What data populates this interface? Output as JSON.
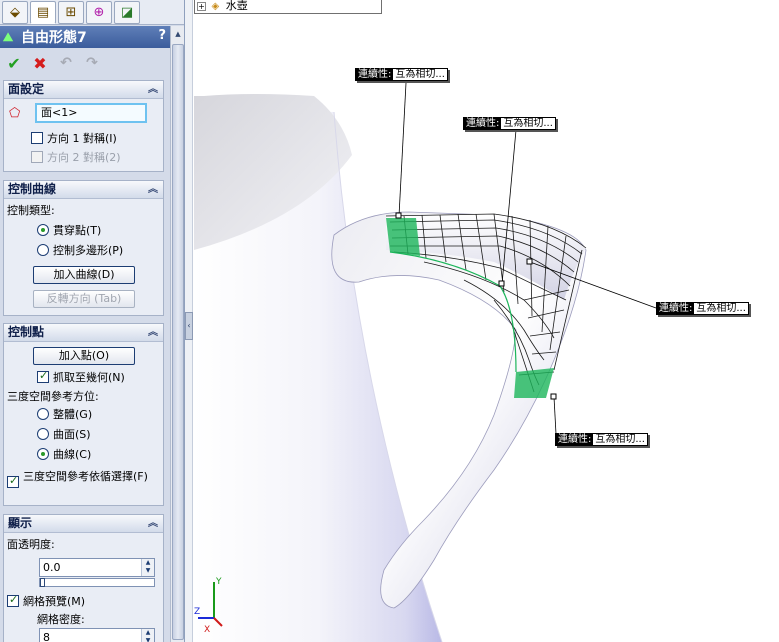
{
  "panel": {
    "title": "自由形態7",
    "help": "?",
    "tabs": [
      "feature-manager",
      "property-manager",
      "configuration-manager",
      "dimxpert-manager",
      "display-manager"
    ],
    "actions": {
      "ok": "✔",
      "cancel": "✖",
      "undo": "↶",
      "redo": "↷"
    },
    "face_settings": {
      "header": "面設定",
      "selection": "面<1>",
      "dir1_label": "方向 1 對稱(I)",
      "dir1_checked": false,
      "dir2_label": "方向 2 對稱(2)",
      "dir2_enabled": false
    },
    "control_curves": {
      "header": "控制曲線",
      "type_label": "控制類型:",
      "option_through_points": "貫穿點(T)",
      "option_control_polygon": "控制多邊形(P)",
      "selected": "through_points",
      "add_curve_button": "加入曲線(D)",
      "reverse_button": "反轉方向 (Tab)"
    },
    "control_points": {
      "header": "控制點",
      "add_points_button": "加入點(O)",
      "snap_label": "抓取至幾何(N)",
      "snap_checked": true,
      "triad_label": "三度空間參考方位:",
      "option_global": "整體(G)",
      "option_surface": "曲面(S)",
      "option_curve": "曲線(C)",
      "selected": "curve",
      "follow_label": "三度空間參考依循選擇(F)",
      "follow_checked": true
    },
    "display": {
      "header": "顯示",
      "transparency_label": "面透明度:",
      "transparency_value": "0.0",
      "transparency_fraction": 0.0,
      "mesh_label": "網格預覽(M)",
      "mesh_checked": true,
      "density_label": "網格密度:",
      "density_value": "8"
    }
  },
  "viewport": {
    "tree_root": "水壺",
    "callouts": [
      {
        "key": "連續性:",
        "value": "互為相切..."
      },
      {
        "key": "連續性:",
        "value": "互為相切..."
      },
      {
        "key": "連續性:",
        "value": "互為相切..."
      },
      {
        "key": "連續性:",
        "value": "互為相切..."
      }
    ],
    "triad": {
      "x": "X",
      "y": "Y",
      "z": "Z"
    }
  },
  "colors": {
    "title_bar": "#3b5c9c",
    "panel_bg": "#d4dbe9",
    "selection_border": "#6ec2f0",
    "model_body": "#f0f0f6",
    "mesh_highlight": "#1cb55a"
  }
}
